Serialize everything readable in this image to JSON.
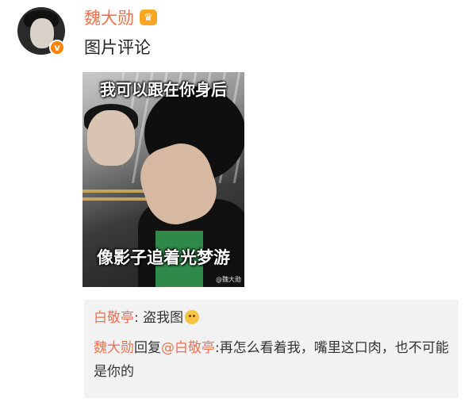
{
  "post": {
    "username": "魏大勋",
    "comment": "图片评论",
    "image": {
      "caption_top": "我可以跟在你身后",
      "caption_bottom": "像影子追着光梦游",
      "watermark": "@魏大勋"
    }
  },
  "replies": [
    {
      "user": "白敬亭",
      "separator": ": ",
      "text": "盗我图"
    },
    {
      "user": "魏大勋",
      "action": "回复",
      "mention": "@白敬亭",
      "separator": ":",
      "text": "再怎么看着我，嘴里这口肉，也不可能是你的"
    }
  ],
  "colors": {
    "accent": "#eb7350",
    "vip_badge": "#ff8200",
    "reply_bg": "#f2f2f2"
  },
  "icons": {
    "verified": "v",
    "crown": "♛"
  }
}
